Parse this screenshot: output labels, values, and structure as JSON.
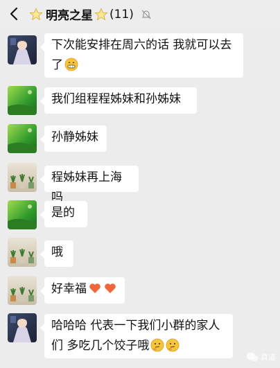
{
  "header": {
    "title": "明亮之星",
    "member_count": "(11)"
  },
  "messages": [
    {
      "avatar": "anime",
      "text": "下次能安排在周六的话 我就可以去了",
      "line1": "下次能安排在周六的话 我就可以去",
      "line2": "了",
      "emoji": [
        "grin"
      ]
    },
    {
      "avatar": "green",
      "text": "我们组程程姊妹和孙姊妹"
    },
    {
      "avatar": "green",
      "text": "孙静姊妹"
    },
    {
      "avatar": "plants",
      "text": "程姊妹再上海吗"
    },
    {
      "avatar": "green",
      "text": "是的"
    },
    {
      "avatar": "plants",
      "text": "哦"
    },
    {
      "avatar": "plants",
      "text": "好幸福",
      "emoji": [
        "heart",
        "heart"
      ]
    },
    {
      "avatar": "anime",
      "text": "哈哈哈 代表一下我们小群的家人们 多吃几个饺子哦",
      "line1": "哈哈哈 代表一下我们小群的家人",
      "line2": "们 多吃几个饺子哦",
      "emoji": [
        "thinking",
        "thinking"
      ]
    }
  ],
  "watermark": {
    "text": "真道"
  },
  "colors": {
    "background": "#ececec",
    "bubble": "#ffffff",
    "heart": "#f0663c",
    "emoji_face": "#f7c53b"
  }
}
